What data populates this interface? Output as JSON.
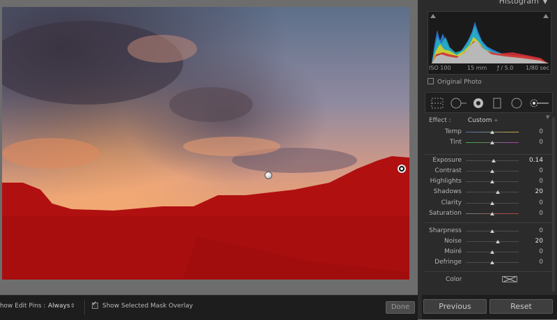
{
  "bottom_toolbar": {
    "edit_pins_label": "Show Edit Pins :",
    "edit_pins_value": "Always",
    "overlay_label": "Show Selected Mask Overlay",
    "done_label": "Done"
  },
  "histogram": {
    "title": "Histogram",
    "iso": "ISO 100",
    "focal": "15 mm",
    "aperture": "ƒ / 5.0",
    "shutter": "1/80 sec",
    "original_photo": "Original Photo"
  },
  "effect": {
    "label": "Effect :",
    "value": "Custom"
  },
  "sliders": [
    {
      "label": "Temp",
      "value": "0",
      "pos": 0.5,
      "track": "temp"
    },
    {
      "label": "Tint",
      "value": "0",
      "pos": 0.5,
      "track": "tint"
    },
    {
      "label": "Exposure",
      "value": "0.14",
      "pos": 0.52,
      "track": "gray",
      "bright": true
    },
    {
      "label": "Contrast",
      "value": "0",
      "pos": 0.5,
      "track": "gray"
    },
    {
      "label": "Highlights",
      "value": "0",
      "pos": 0.5,
      "track": "gray"
    },
    {
      "label": "Shadows",
      "value": "20",
      "pos": 0.6,
      "track": "gray",
      "bright": true
    },
    {
      "label": "Clarity",
      "value": "0",
      "pos": 0.5,
      "track": "gray"
    },
    {
      "label": "Saturation",
      "value": "0",
      "pos": 0.5,
      "track": "sat"
    },
    {
      "label": "Sharpness",
      "value": "0",
      "pos": 0.5,
      "track": "gray"
    },
    {
      "label": "Noise",
      "value": "20",
      "pos": 0.6,
      "track": "gray",
      "bright": true
    },
    {
      "label": "Moiré",
      "value": "0",
      "pos": 0.5,
      "track": "gray"
    },
    {
      "label": "Defringe",
      "value": "0",
      "pos": 0.5,
      "track": "gray"
    }
  ],
  "color_label": "Color",
  "buttons": {
    "previous": "Previous",
    "reset": "Reset"
  },
  "colors": {
    "mask_overlay": "#b01010",
    "panel_bg": "#2b2b2b",
    "toolbar_bg": "#1d1d1d"
  }
}
